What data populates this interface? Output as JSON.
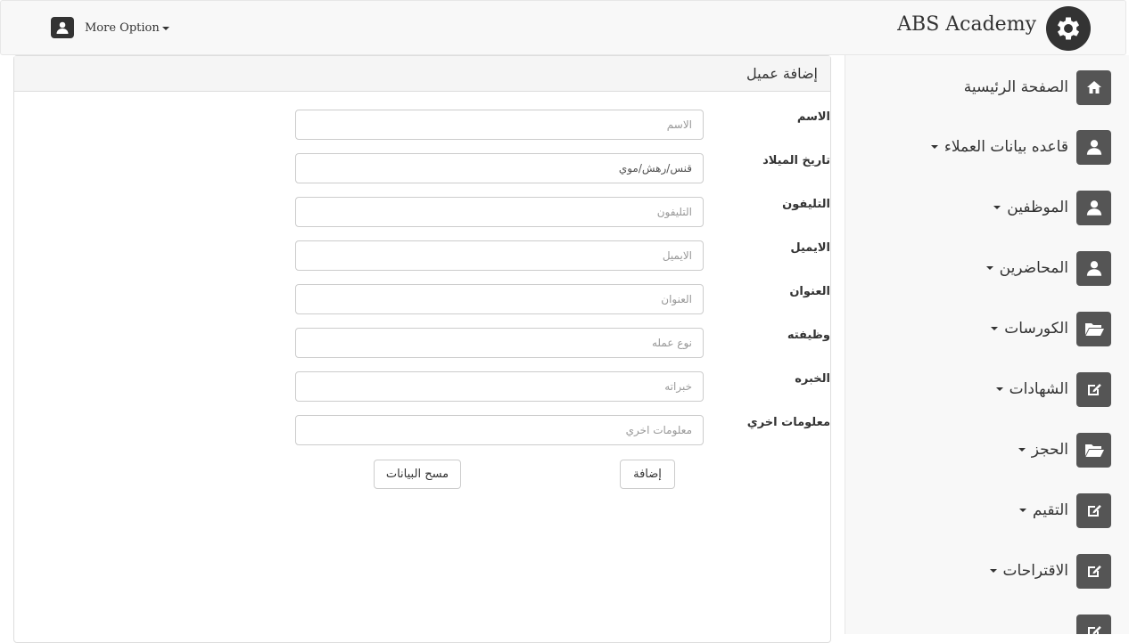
{
  "header": {
    "brand": "ABS Academy",
    "brand_icon": "gear-icon",
    "user_icon": "user-icon",
    "more_option": "More Option"
  },
  "sidebar": {
    "items": [
      {
        "label": "الصفحة الرئيسية",
        "icon": "home-icon",
        "dropdown": false
      },
      {
        "label": "قاعده بيانات العملاء",
        "icon": "user-icon",
        "dropdown": true
      },
      {
        "label": "الموظفين",
        "icon": "user-icon",
        "dropdown": true
      },
      {
        "label": "المحاضرين",
        "icon": "user-icon",
        "dropdown": true
      },
      {
        "label": "الكورسات",
        "icon": "folder-open-icon",
        "dropdown": true
      },
      {
        "label": "الشهادات",
        "icon": "edit-icon",
        "dropdown": true
      },
      {
        "label": "الحجز",
        "icon": "folder-open-icon",
        "dropdown": true
      },
      {
        "label": "التقيم",
        "icon": "edit-icon",
        "dropdown": true
      },
      {
        "label": "الاقتراحات",
        "icon": "edit-icon",
        "dropdown": true
      }
    ]
  },
  "panel": {
    "title": "إضافة عميل"
  },
  "form": {
    "fields": [
      {
        "label": "الاسم",
        "placeholder": "الاسم",
        "value": ""
      },
      {
        "label": "تاريخ الميلاد",
        "placeholder": "",
        "value": "ﻗﻨﺲ/رﻫﺶ/ﻣﻮي"
      },
      {
        "label": "التليفون",
        "placeholder": "التليفون",
        "value": ""
      },
      {
        "label": "الايميل",
        "placeholder": "الايميل",
        "value": ""
      },
      {
        "label": "العنوان",
        "placeholder": "العنوان",
        "value": ""
      },
      {
        "label": "وظيفته",
        "placeholder": "نوع عمله",
        "value": ""
      },
      {
        "label": "الخبره",
        "placeholder": "خبراته",
        "value": ""
      },
      {
        "label": "معلومات اخري",
        "placeholder": "معلومات اخري",
        "value": ""
      }
    ],
    "add_button": "إضافة",
    "clear_button": "مسح البيانات"
  },
  "colors": {
    "navbar_bg": "#f8f8f8",
    "icon_dark": "#333333",
    "sidebar_icon_bg": "#555555",
    "panel_heading_bg": "#f5f5f5"
  }
}
